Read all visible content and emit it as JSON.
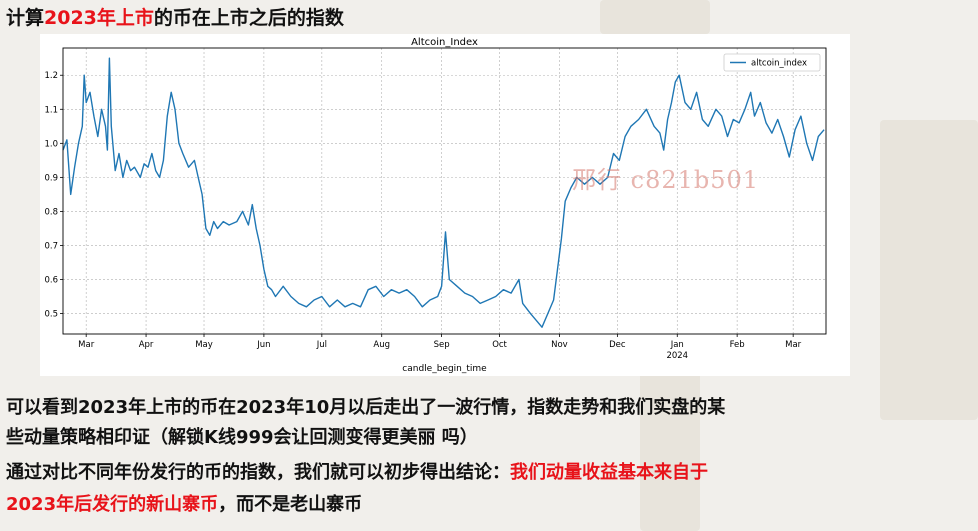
{
  "title": {
    "prefix": "计算",
    "highlight": "2023年上市",
    "suffix": "的币在上市之后的指数"
  },
  "watermark": "邢行 c821b501",
  "paragraphs": {
    "line1": "可以看到2023年上市的币在2023年10月以后走出了一波行情，指数走势和我们实盘的某",
    "line2": "些动量策略相印证（解锁K线999会让回测变得更美丽 吗）",
    "line3_plain": "通过对比不同年份发行的币的指数，我们就可以初步得出结论：",
    "line3_red": "我们动量收益基本来自于",
    "line4_red": "2023年后发行的新山寨币",
    "line4_plain": "，而不是老山寨币"
  },
  "colors": {
    "line": "#1f77b4",
    "highlight_red": "#e8131a",
    "background": "#f1efeb"
  },
  "chart_data": {
    "type": "line",
    "title": "Altcoin_Index",
    "xlabel": "candle_begin_time",
    "ylabel": "",
    "xlim": [
      0,
      395
    ],
    "ylim": [
      0.44,
      1.28
    ],
    "x_tick_labels": [
      "Mar",
      "Apr",
      "May",
      "Jun",
      "Jul",
      "Aug",
      "Sep",
      "Oct",
      "Nov",
      "Dec",
      "Jan",
      "Feb",
      "Mar"
    ],
    "x_tick_positions": [
      12,
      43,
      73,
      104,
      134,
      165,
      196,
      226,
      257,
      287,
      318,
      349,
      378
    ],
    "x_tick_sublabel": "2024",
    "y_ticks": [
      0.5,
      0.6,
      0.7,
      0.8,
      0.9,
      1.0,
      1.1,
      1.2
    ],
    "y_tick_labels": [
      "0.5",
      "0.6",
      "0.7",
      "0.8",
      "0.9",
      "1.0",
      "1.1",
      "1.2"
    ],
    "grid": true,
    "legend_position": "top-right",
    "series": [
      {
        "name": "altcoin_index",
        "color": "#1f77b4",
        "points": [
          [
            0,
            0.98
          ],
          [
            2,
            1.01
          ],
          [
            4,
            0.85
          ],
          [
            6,
            0.93
          ],
          [
            8,
            1.0
          ],
          [
            10,
            1.05
          ],
          [
            11,
            1.2
          ],
          [
            12,
            1.12
          ],
          [
            14,
            1.15
          ],
          [
            16,
            1.08
          ],
          [
            18,
            1.02
          ],
          [
            20,
            1.1
          ],
          [
            22,
            1.05
          ],
          [
            23,
            0.98
          ],
          [
            24,
            1.25
          ],
          [
            25,
            1.05
          ],
          [
            27,
            0.92
          ],
          [
            29,
            0.97
          ],
          [
            31,
            0.9
          ],
          [
            33,
            0.95
          ],
          [
            35,
            0.92
          ],
          [
            37,
            0.93
          ],
          [
            40,
            0.9
          ],
          [
            42,
            0.94
          ],
          [
            44,
            0.93
          ],
          [
            46,
            0.97
          ],
          [
            48,
            0.92
          ],
          [
            50,
            0.9
          ],
          [
            52,
            0.95
          ],
          [
            54,
            1.08
          ],
          [
            56,
            1.15
          ],
          [
            58,
            1.1
          ],
          [
            60,
            1.0
          ],
          [
            62,
            0.97
          ],
          [
            65,
            0.93
          ],
          [
            68,
            0.95
          ],
          [
            70,
            0.9
          ],
          [
            72,
            0.85
          ],
          [
            74,
            0.75
          ],
          [
            76,
            0.73
          ],
          [
            78,
            0.77
          ],
          [
            80,
            0.75
          ],
          [
            83,
            0.77
          ],
          [
            86,
            0.76
          ],
          [
            90,
            0.77
          ],
          [
            93,
            0.8
          ],
          [
            96,
            0.76
          ],
          [
            98,
            0.82
          ],
          [
            100,
            0.75
          ],
          [
            102,
            0.7
          ],
          [
            104,
            0.63
          ],
          [
            106,
            0.58
          ],
          [
            108,
            0.57
          ],
          [
            110,
            0.55
          ],
          [
            114,
            0.58
          ],
          [
            118,
            0.55
          ],
          [
            122,
            0.53
          ],
          [
            126,
            0.52
          ],
          [
            130,
            0.54
          ],
          [
            134,
            0.55
          ],
          [
            138,
            0.52
          ],
          [
            142,
            0.54
          ],
          [
            146,
            0.52
          ],
          [
            150,
            0.53
          ],
          [
            154,
            0.52
          ],
          [
            158,
            0.57
          ],
          [
            162,
            0.58
          ],
          [
            166,
            0.55
          ],
          [
            170,
            0.57
          ],
          [
            174,
            0.56
          ],
          [
            178,
            0.57
          ],
          [
            182,
            0.55
          ],
          [
            186,
            0.52
          ],
          [
            190,
            0.54
          ],
          [
            194,
            0.55
          ],
          [
            196,
            0.58
          ],
          [
            198,
            0.74
          ],
          [
            200,
            0.6
          ],
          [
            204,
            0.58
          ],
          [
            208,
            0.56
          ],
          [
            212,
            0.55
          ],
          [
            216,
            0.53
          ],
          [
            220,
            0.54
          ],
          [
            224,
            0.55
          ],
          [
            228,
            0.57
          ],
          [
            232,
            0.56
          ],
          [
            236,
            0.6
          ],
          [
            238,
            0.53
          ],
          [
            242,
            0.5
          ],
          [
            245,
            0.48
          ],
          [
            248,
            0.46
          ],
          [
            251,
            0.5
          ],
          [
            254,
            0.54
          ],
          [
            256,
            0.63
          ],
          [
            258,
            0.72
          ],
          [
            260,
            0.83
          ],
          [
            263,
            0.87
          ],
          [
            266,
            0.9
          ],
          [
            270,
            0.88
          ],
          [
            274,
            0.9
          ],
          [
            278,
            0.88
          ],
          [
            282,
            0.9
          ],
          [
            285,
            0.97
          ],
          [
            288,
            0.95
          ],
          [
            291,
            1.02
          ],
          [
            294,
            1.05
          ],
          [
            298,
            1.07
          ],
          [
            302,
            1.1
          ],
          [
            306,
            1.05
          ],
          [
            309,
            1.03
          ],
          [
            311,
            0.98
          ],
          [
            313,
            1.07
          ],
          [
            315,
            1.12
          ],
          [
            317,
            1.18
          ],
          [
            319,
            1.2
          ],
          [
            322,
            1.12
          ],
          [
            325,
            1.1
          ],
          [
            328,
            1.15
          ],
          [
            331,
            1.07
          ],
          [
            334,
            1.05
          ],
          [
            338,
            1.1
          ],
          [
            341,
            1.08
          ],
          [
            344,
            1.02
          ],
          [
            347,
            1.07
          ],
          [
            350,
            1.06
          ],
          [
            353,
            1.1
          ],
          [
            356,
            1.15
          ],
          [
            358,
            1.08
          ],
          [
            361,
            1.12
          ],
          [
            364,
            1.06
          ],
          [
            367,
            1.03
          ],
          [
            370,
            1.07
          ],
          [
            373,
            1.02
          ],
          [
            376,
            0.96
          ],
          [
            379,
            1.04
          ],
          [
            382,
            1.08
          ],
          [
            385,
            1.0
          ],
          [
            388,
            0.95
          ],
          [
            391,
            1.02
          ],
          [
            394,
            1.04
          ]
        ]
      }
    ]
  }
}
